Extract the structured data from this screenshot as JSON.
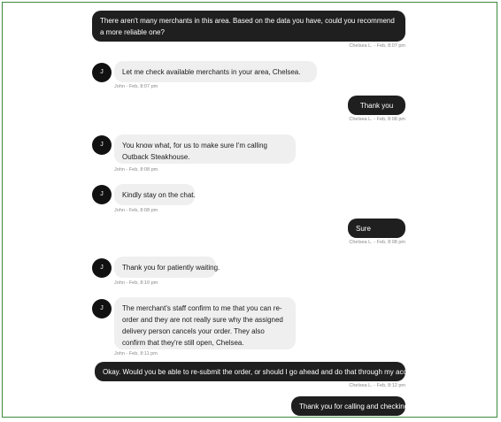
{
  "messages": [
    {
      "from": "Chelsea",
      "text": "There aren't many merchants in this area. Based on the data you have, could you recommend a more reliable one?",
      "meta": "Chelsea L. - Feb, 8:07 pm"
    },
    {
      "from": "John",
      "avatar": "J",
      "text": "Let me check available merchants in your area, Chelsea.",
      "meta": "John - Feb, 8:07 pm"
    },
    {
      "from": "Chelsea",
      "text": "Thank you",
      "meta": "Chelsea L. - Feb, 8:08 pm"
    },
    {
      "from": "John",
      "avatar": "J",
      "text": "You know what, for us to make sure I'm calling Outback Steakhouse.",
      "meta": "John - Feb, 8:08 pm"
    },
    {
      "from": "John",
      "avatar": "J",
      "text": "Kindly stay on the chat.",
      "meta": "John - Feb, 8:08 pm"
    },
    {
      "from": "Chelsea",
      "text": "Sure",
      "meta": "Chelsea L. - Feb, 8:08 pm"
    },
    {
      "from": "John",
      "avatar": "J",
      "text": "Thank you for patiently waiting.",
      "meta": "John - Feb, 8:10 pm"
    },
    {
      "from": "John",
      "avatar": "J",
      "text": "The merchant's staff confirm to me that you can re-order and they are not really sure why the assigned delivery person cancels your order. They also confirm that they're still open, Chelsea.",
      "meta": "John - Feb, 8:11 pm"
    },
    {
      "from": "Chelsea",
      "text": "Okay. Would you be able to re-submit the order, or should I go ahead and do that through my account?",
      "meta": "Chelsea L. - Feb, 8:12 pm"
    },
    {
      "from": "Chelsea",
      "text": "Thank you for calling and checking!",
      "meta": ""
    }
  ]
}
